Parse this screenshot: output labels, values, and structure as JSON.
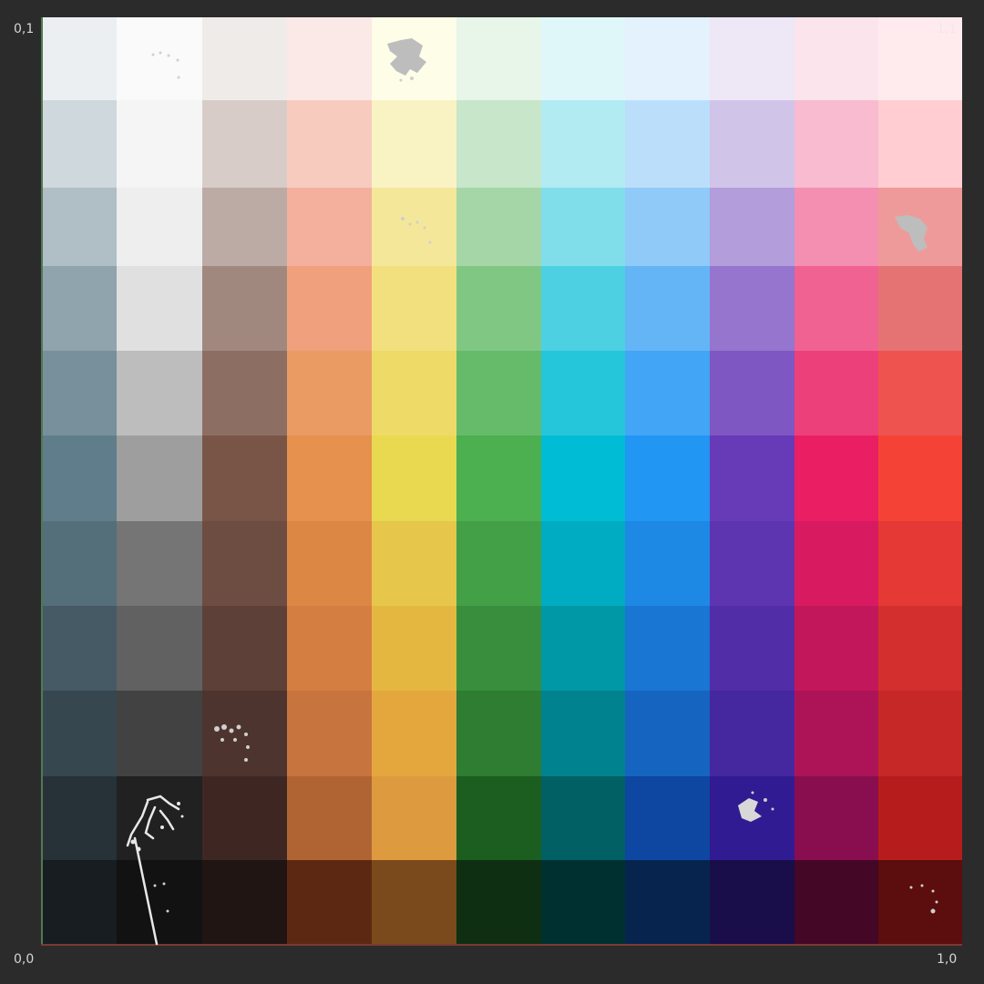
{
  "corner_labels": {
    "top_left": "0,1",
    "top_right": "1,1",
    "bottom_left": "0,0",
    "bottom_right": "1,0"
  },
  "axis_colors": {
    "v_axis": "#4f7a52",
    "u_axis": "#7a3a35"
  },
  "palette": {
    "columns": [
      {
        "name": "blue-grey",
        "shades": [
          "#eceff1",
          "#cfd8dc",
          "#b0bec5",
          "#90a4ae",
          "#78909c",
          "#607d8b",
          "#546e7a",
          "#455a64",
          "#37474f",
          "#263238",
          "#171d21"
        ]
      },
      {
        "name": "grey",
        "shades": [
          "#fafafa",
          "#f5f5f5",
          "#eeeeee",
          "#e0e0e0",
          "#bdbdbd",
          "#9e9e9e",
          "#757575",
          "#616161",
          "#424242",
          "#212121",
          "#121212"
        ]
      },
      {
        "name": "brown",
        "shades": [
          "#efebe9",
          "#d7ccc8",
          "#bcaaa4",
          "#a1887f",
          "#8d6e63",
          "#795548",
          "#6d4c41",
          "#5d4037",
          "#4e342e",
          "#3e2723",
          "#201513"
        ]
      },
      {
        "name": "orange",
        "shades": [
          "#fbe9e7",
          "#f8cbbf",
          "#f4b09c",
          "#f0a07c",
          "#e99b63",
          "#e6914d",
          "#dd8745",
          "#d47e42",
          "#c8743e",
          "#b06433",
          "#5d2812"
        ]
      },
      {
        "name": "yellow",
        "shades": [
          "#fefde7",
          "#f9f3c4",
          "#f5e79a",
          "#f2e07e",
          "#eedb67",
          "#e8d950",
          "#e6c64b",
          "#e4b741",
          "#e4a73e",
          "#dd9a3e",
          "#7a4a1c"
        ]
      },
      {
        "name": "green",
        "shades": [
          "#e8f5e9",
          "#c8e6c9",
          "#a5d6a7",
          "#81c784",
          "#66bb6a",
          "#4caf50",
          "#43a047",
          "#388e3c",
          "#2e7d32",
          "#1b5e20",
          "#0f2f12"
        ]
      },
      {
        "name": "cyan",
        "shades": [
          "#e0f7fa",
          "#b2ebf2",
          "#80deea",
          "#4dd0e1",
          "#26c6da",
          "#00bcd4",
          "#00acc1",
          "#0097a7",
          "#00838f",
          "#006064",
          "#00302f"
        ]
      },
      {
        "name": "blue",
        "shades": [
          "#e3f2fd",
          "#bbdefb",
          "#90caf9",
          "#64b5f6",
          "#42a5f5",
          "#2196f3",
          "#1e88e5",
          "#1976d2",
          "#1565c0",
          "#0d47a1",
          "#07244f"
        ]
      },
      {
        "name": "deep-purple",
        "shades": [
          "#ede7f6",
          "#d1c4e9",
          "#b39ddb",
          "#9575cd",
          "#7e57c2",
          "#673ab7",
          "#5e35b1",
          "#512da8",
          "#4527a0",
          "#311b92",
          "#1a0e4a"
        ]
      },
      {
        "name": "pink",
        "shades": [
          "#fce4ec",
          "#f8bbd0",
          "#f48fb1",
          "#f06292",
          "#ec407a",
          "#e91e63",
          "#d81b60",
          "#c2185b",
          "#ad1457",
          "#880e4f",
          "#440726"
        ]
      },
      {
        "name": "red",
        "shades": [
          "#ffebee",
          "#ffcdd2",
          "#ef9a9a",
          "#e57373",
          "#ef5350",
          "#f44336",
          "#e53935",
          "#d32f2f",
          "#c62828",
          "#b71c1c",
          "#5c0d0d"
        ]
      }
    ]
  }
}
